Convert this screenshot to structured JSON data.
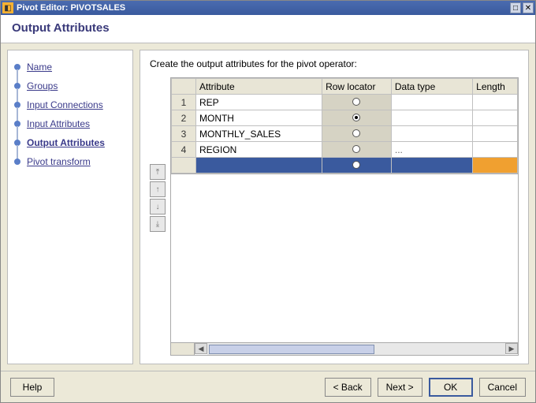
{
  "window": {
    "title": "Pivot Editor: PIVOTSALES"
  },
  "heading": "Output Attributes",
  "sidebar": {
    "items": [
      {
        "label": "Name",
        "current": false
      },
      {
        "label": "Groups",
        "current": false
      },
      {
        "label": "Input Connections",
        "current": false
      },
      {
        "label": "Input Attributes",
        "current": false
      },
      {
        "label": "Output Attributes",
        "current": true
      },
      {
        "label": "Pivot transform",
        "current": false
      }
    ]
  },
  "content": {
    "instruction": "Create the output attributes for the pivot operator:",
    "columns": {
      "attribute": "Attribute",
      "row_locator": "Row locator",
      "data_type": "Data type",
      "length": "Length"
    },
    "rows": [
      {
        "num": "1",
        "attribute": "REP",
        "row_locator_checked": false,
        "data_type": "",
        "length": ""
      },
      {
        "num": "2",
        "attribute": "MONTH",
        "row_locator_checked": true,
        "data_type": "",
        "length": ""
      },
      {
        "num": "3",
        "attribute": "MONTHLY_SALES",
        "row_locator_checked": false,
        "data_type": "",
        "length": ""
      },
      {
        "num": "4",
        "attribute": "REGION",
        "row_locator_checked": false,
        "data_type": "...",
        "length": ""
      }
    ],
    "new_row": {
      "num": "",
      "attribute": "",
      "row_locator_checked": false,
      "data_type": "",
      "length": ""
    }
  },
  "footer": {
    "help": "Help",
    "back": "< Back",
    "next": "Next >",
    "ok": "OK",
    "cancel": "Cancel"
  }
}
